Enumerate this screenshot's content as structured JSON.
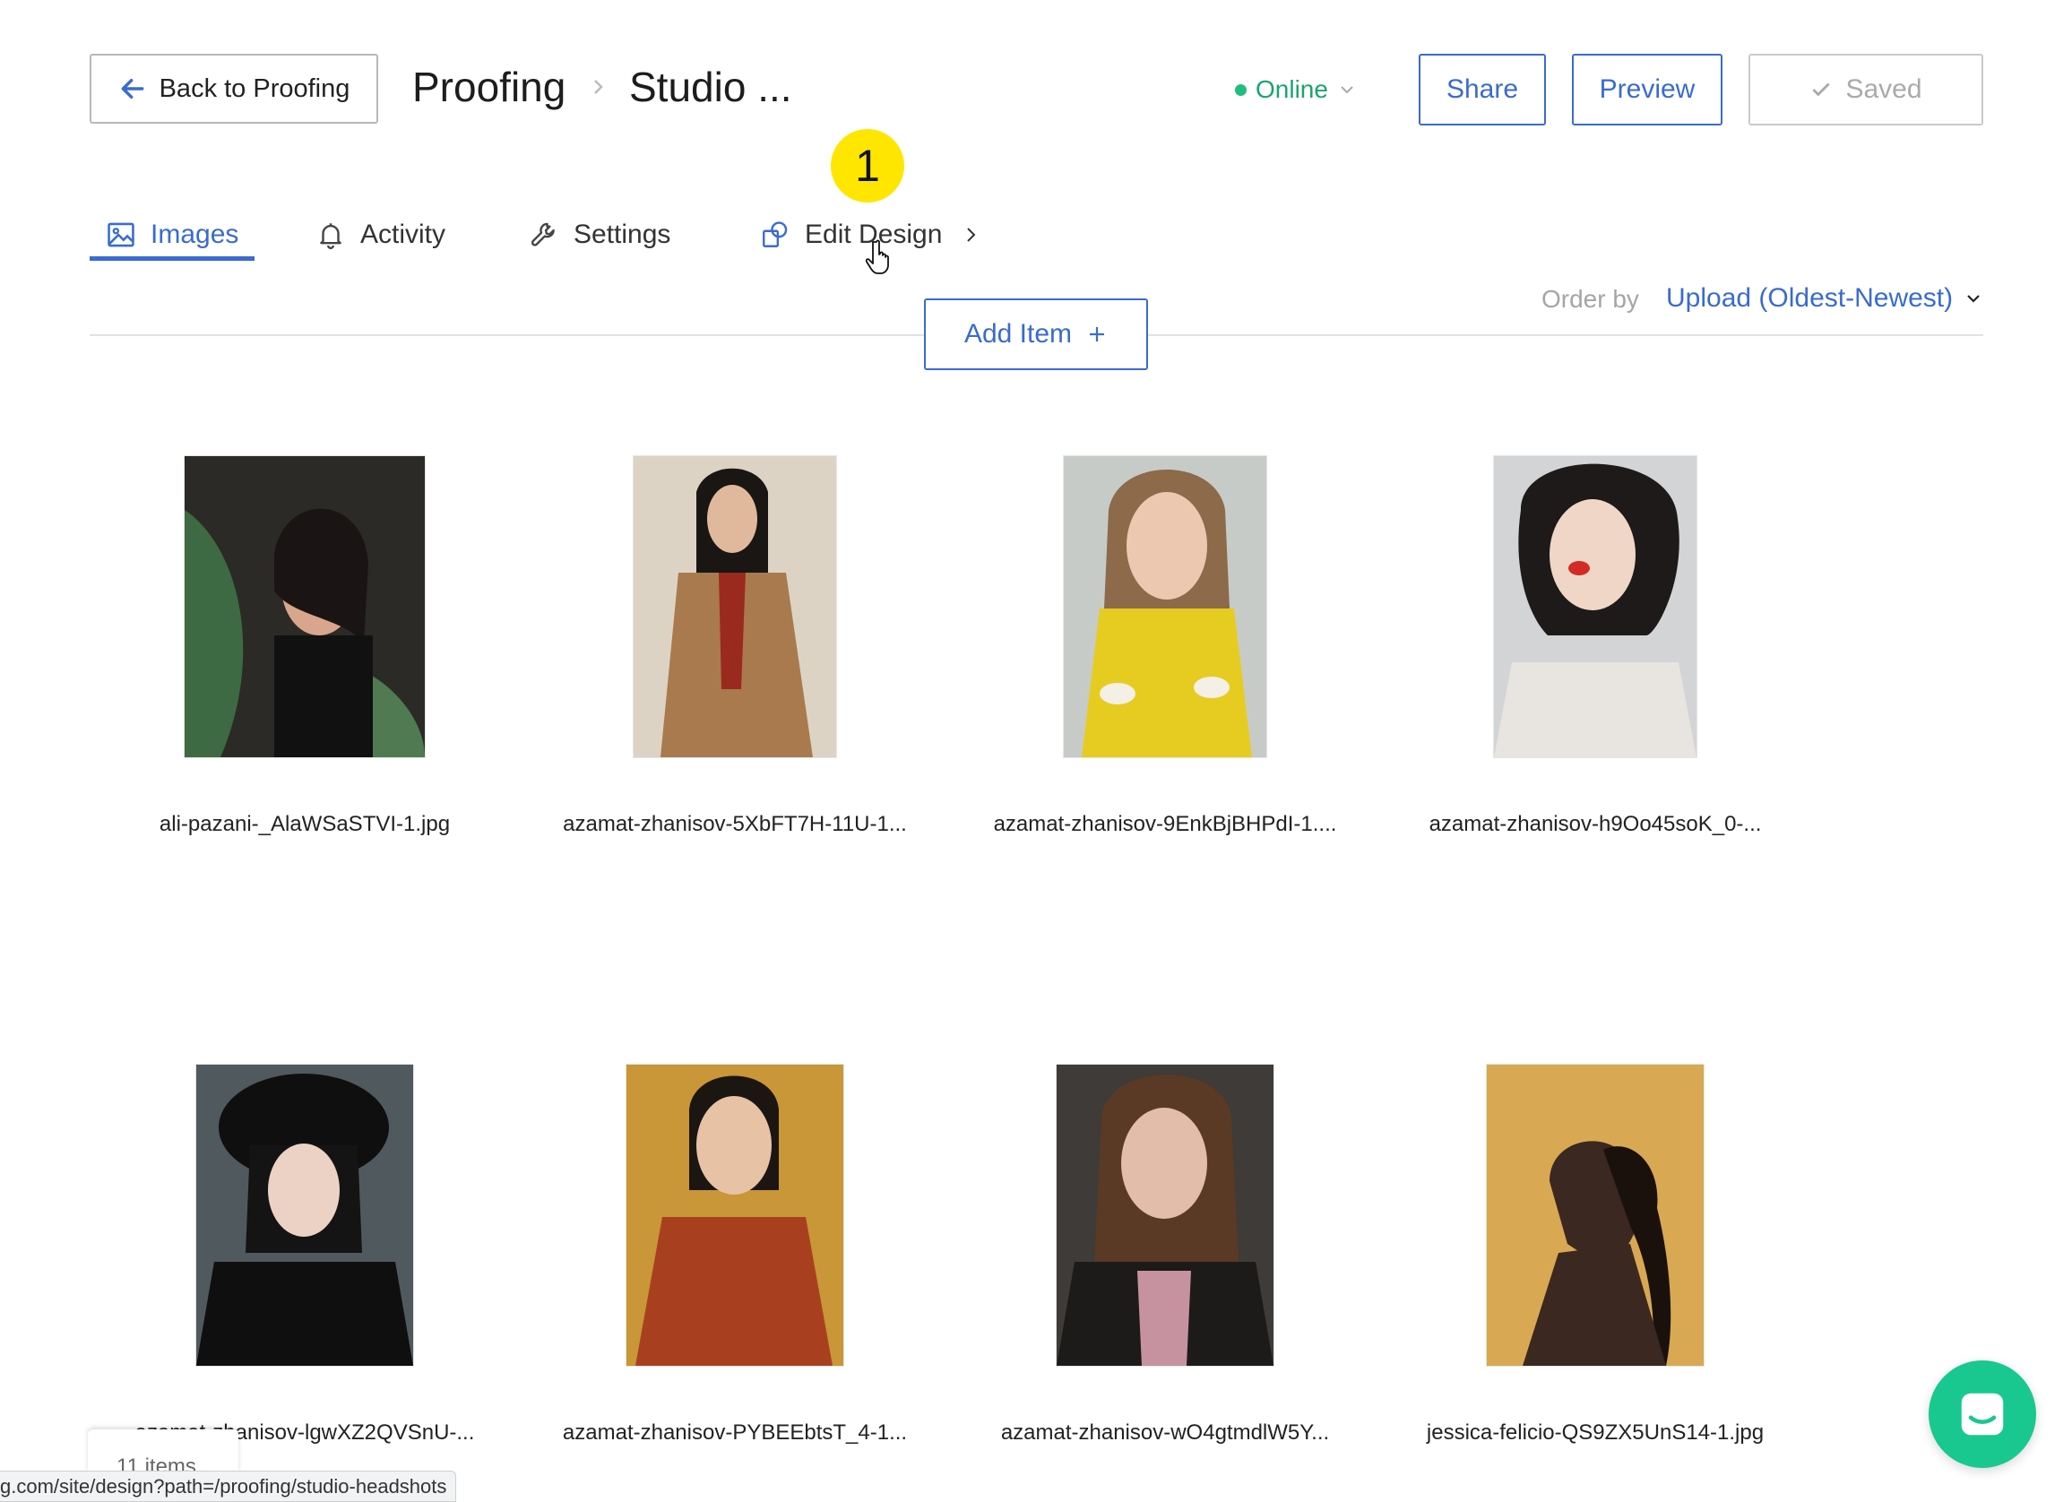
{
  "header": {
    "back_label": "Back to Proofing",
    "breadcrumb": [
      "Proofing",
      "Studio ..."
    ],
    "status": "Online",
    "share_label": "Share",
    "preview_label": "Preview",
    "saved_label": "Saved"
  },
  "annotation": {
    "step": "1"
  },
  "tabs": [
    {
      "label": "Images",
      "icon": "image-icon",
      "active": true
    },
    {
      "label": "Activity",
      "icon": "bell-icon",
      "active": false
    },
    {
      "label": "Settings",
      "icon": "wrench-icon",
      "active": false
    },
    {
      "label": "Edit Design",
      "icon": "design-icon",
      "active": false
    }
  ],
  "toolbar": {
    "add_item_label": "Add Item",
    "order_by_label": "Order by",
    "order_by_value": "Upload (Oldest-Newest)"
  },
  "images": [
    {
      "filename": "ali-pazani-_AlaWSaSTVI-1.jpg",
      "bg": "#2b3a2c",
      "accent": "#4f7a52",
      "skin": "#d9a58c"
    },
    {
      "filename": "azamat-zhanisov-5XbFT7H-11U-1...",
      "bg": "#ddd3c4",
      "accent": "#a97a4d",
      "skin": "#e0b99c"
    },
    {
      "filename": "azamat-zhanisov-9EnkBjBHPdI-1....",
      "bg": "#c7cbc8",
      "accent": "#e6cc21",
      "skin": "#edc8b1"
    },
    {
      "filename": "azamat-zhanisov-h9Oo45soK_0-...",
      "bg": "#d2d4d6",
      "accent": "#e8e4e0",
      "skin": "#f0d6c6"
    },
    {
      "filename": "azamat-zhanisov-lgwXZ2QVSnU-...",
      "bg": "#505a5e",
      "accent": "#0f0f0f",
      "skin": "#ecd2c4"
    },
    {
      "filename": "azamat-zhanisov-PYBEEbtsT_4-1...",
      "bg": "#c99638",
      "accent": "#a8401f",
      "skin": "#e8c2a5"
    },
    {
      "filename": "azamat-zhanisov-wO4gtmdlW5Y...",
      "bg": "#3e3b38",
      "accent": "#1d1b1a",
      "skin": "#e2bda9"
    },
    {
      "filename": "jessica-felicio-QS9ZX5UnS14-1.jpg",
      "bg": "#d8a853",
      "accent": "#2a1c15",
      "skin": "#3b2820"
    }
  ],
  "footer": {
    "items_count": "11 items",
    "status_url": "g.com/site/design?path=/proofing/studio-headshots"
  }
}
